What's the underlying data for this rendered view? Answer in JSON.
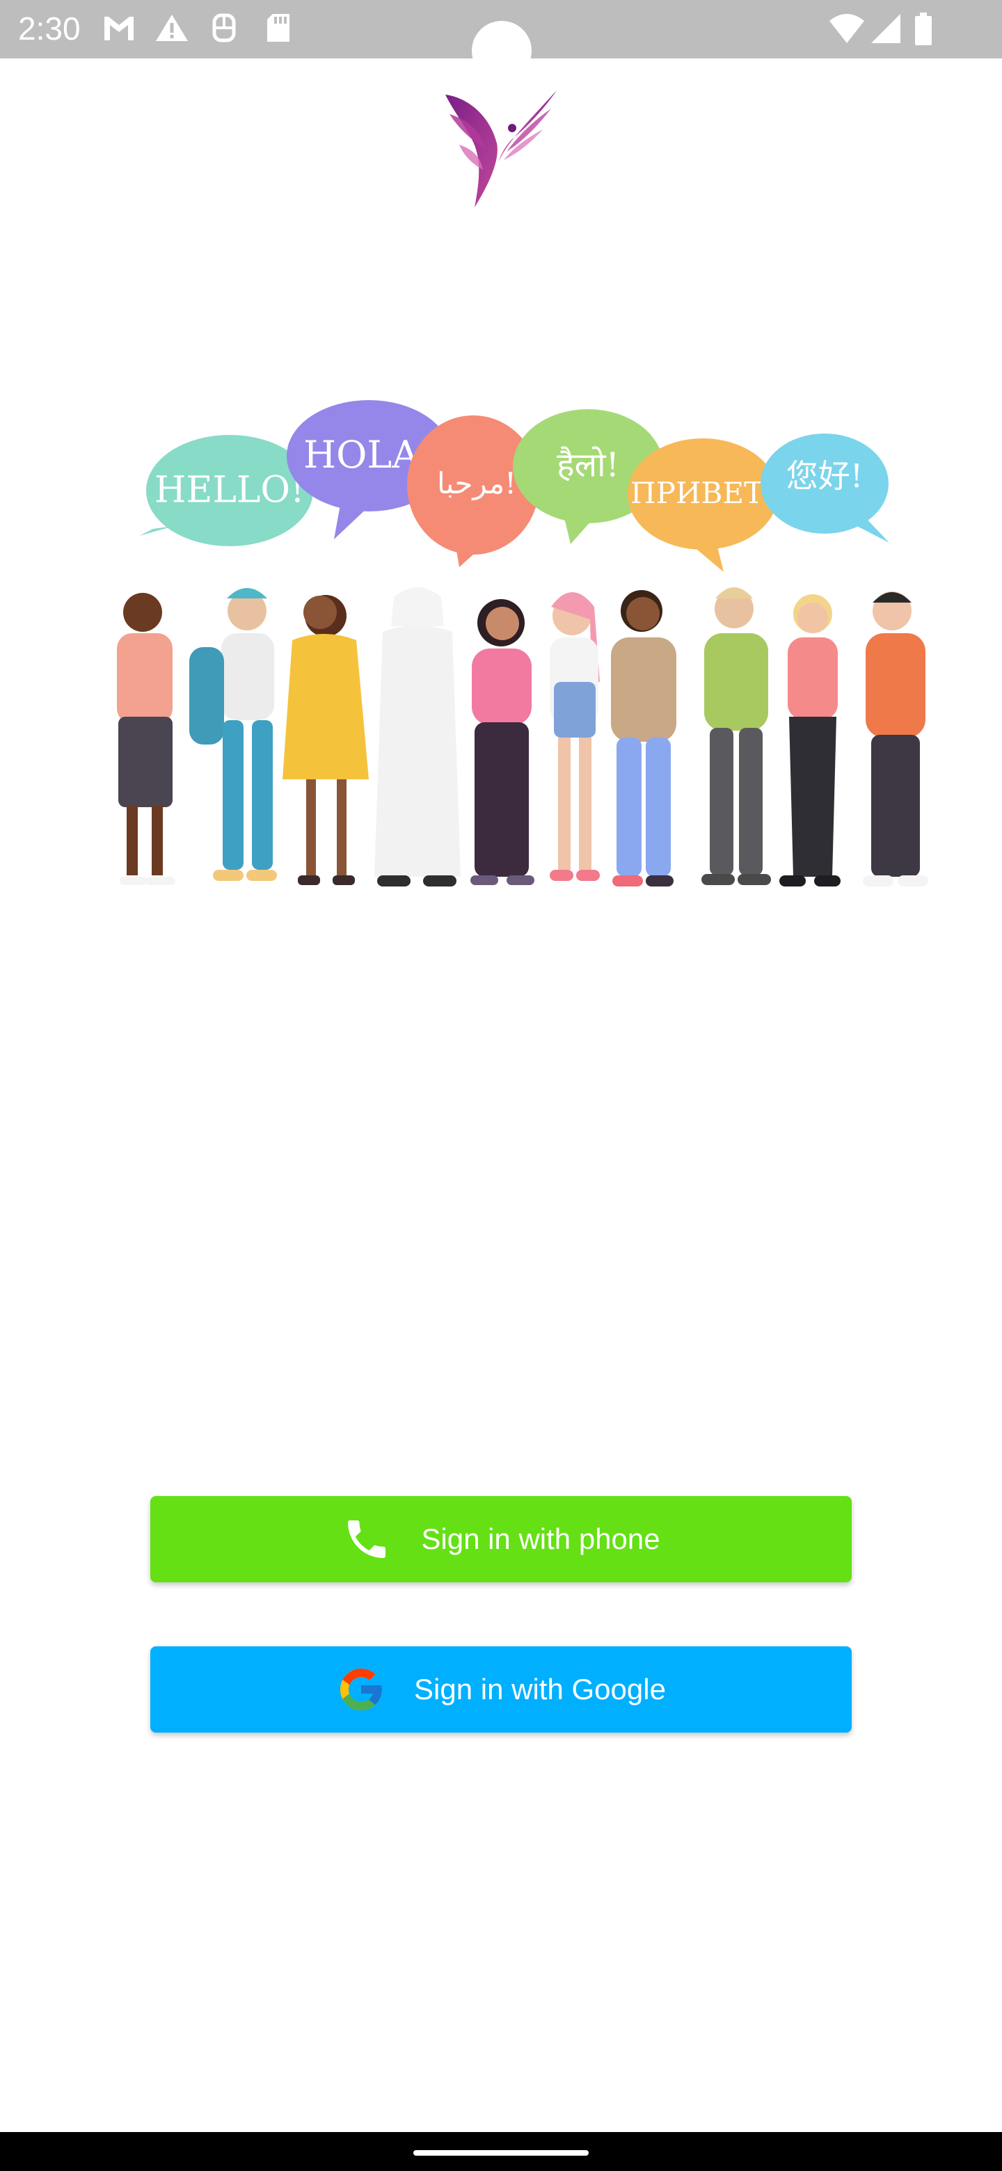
{
  "status_bar": {
    "time": "2:30",
    "icons": [
      "gmail-icon",
      "warning-icon",
      "app-notification-icon",
      "sd-card-icon",
      "wifi-icon",
      "signal-icon",
      "battery-icon"
    ]
  },
  "logo": {
    "icon": "bird-logo-icon"
  },
  "hero": {
    "bubbles": [
      {
        "text": "HELLO!",
        "color": "#7dd8c3"
      },
      {
        "text": "HOLA!",
        "color": "#8b7de8"
      },
      {
        "text": "مرحبا!",
        "color": "#f5826a"
      },
      {
        "text": "हैलो!",
        "color": "#9ed66a"
      },
      {
        "text": "ПРИВЕТ!",
        "color": "#f7b34a"
      },
      {
        "text": "您好!",
        "color": "#6fd1ea"
      }
    ]
  },
  "buttons": {
    "phone": {
      "label": "Sign in with phone",
      "icon": "phone-icon",
      "color": "#64e015"
    },
    "google": {
      "label": "Sign in with Google",
      "icon": "google-icon",
      "color": "#00b0ff"
    }
  },
  "nav_bar": {
    "handle": "home-gesture-handle"
  }
}
